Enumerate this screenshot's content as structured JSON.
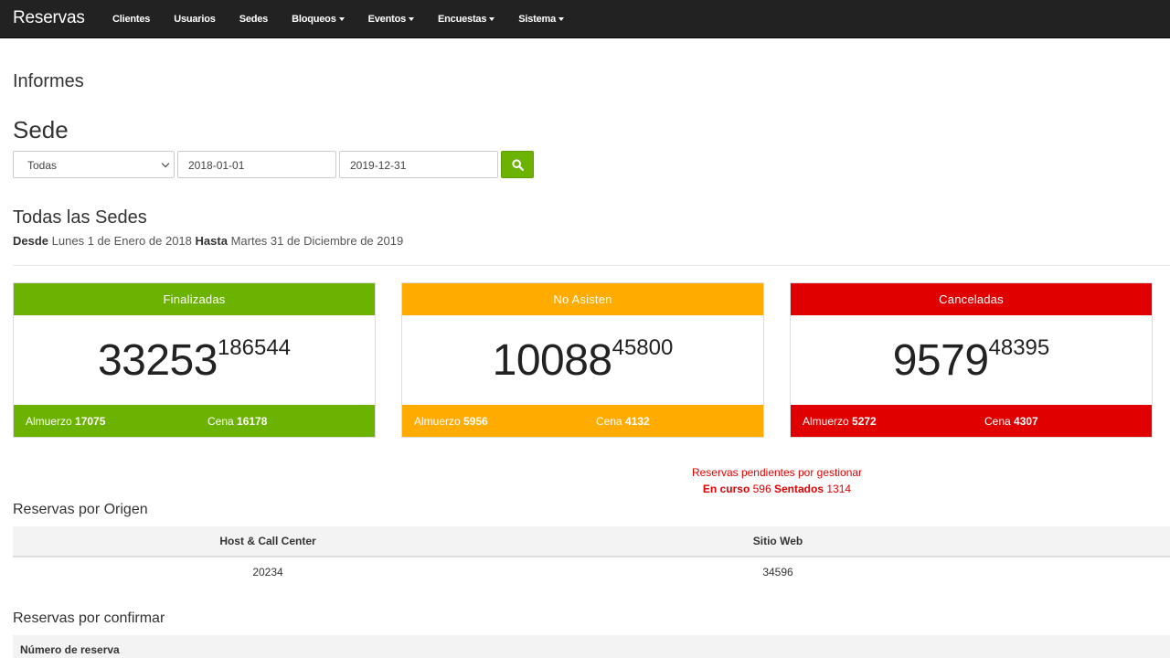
{
  "navbar": {
    "brand": "Reservas",
    "items": [
      {
        "label": "Clientes",
        "dropdown": false
      },
      {
        "label": "Usuarios",
        "dropdown": false
      },
      {
        "label": "Sedes",
        "dropdown": false
      },
      {
        "label": "Bloqueos",
        "dropdown": true
      },
      {
        "label": "Eventos",
        "dropdown": true
      },
      {
        "label": "Encuestas",
        "dropdown": true
      },
      {
        "label": "Sistema",
        "dropdown": true
      }
    ]
  },
  "page_title": "Informes",
  "filter": {
    "heading": "Sede",
    "sede_selected": "Todas",
    "date_from": "2018-01-01",
    "date_to": "2019-12-31",
    "search_icon": "search-icon"
  },
  "summary": {
    "title": "Todas las Sedes",
    "from_label": "Desde",
    "from_value": "Lunes 1 de Enero de 2018",
    "to_label": "Hasta",
    "to_value": "Martes 31 de Diciembre de 2019"
  },
  "cards": [
    {
      "title": "Finalizadas",
      "count": "33253",
      "sup": "186544",
      "lunch_label": "Almuerzo",
      "lunch": "17075",
      "dinner_label": "Cena",
      "dinner": "16178",
      "color": "#6bb300"
    },
    {
      "title": "No Asisten",
      "count": "10088",
      "sup": "45800",
      "lunch_label": "Almuerzo",
      "lunch": "5956",
      "dinner_label": "Cena",
      "dinner": "4132",
      "color": "#ffab00"
    },
    {
      "title": "Canceladas",
      "count": "9579",
      "sup": "48395",
      "lunch_label": "Almuerzo",
      "lunch": "5272",
      "dinner_label": "Cena",
      "dinner": "4307",
      "color": "#e00000"
    }
  ],
  "pending": {
    "title": "Reservas pendientes por gestionar",
    "in_progress_label": "En curso",
    "in_progress": "596",
    "seated_label": "Sentados",
    "seated": "1314"
  },
  "origin": {
    "heading": "Reservas por Origen",
    "columns": [
      "Host & Call Center",
      "Sitio Web"
    ],
    "values": [
      "20234",
      "34596"
    ]
  },
  "to_confirm": {
    "heading": "Reservas por confirmar",
    "columns": [
      "Número de reserva"
    ]
  }
}
